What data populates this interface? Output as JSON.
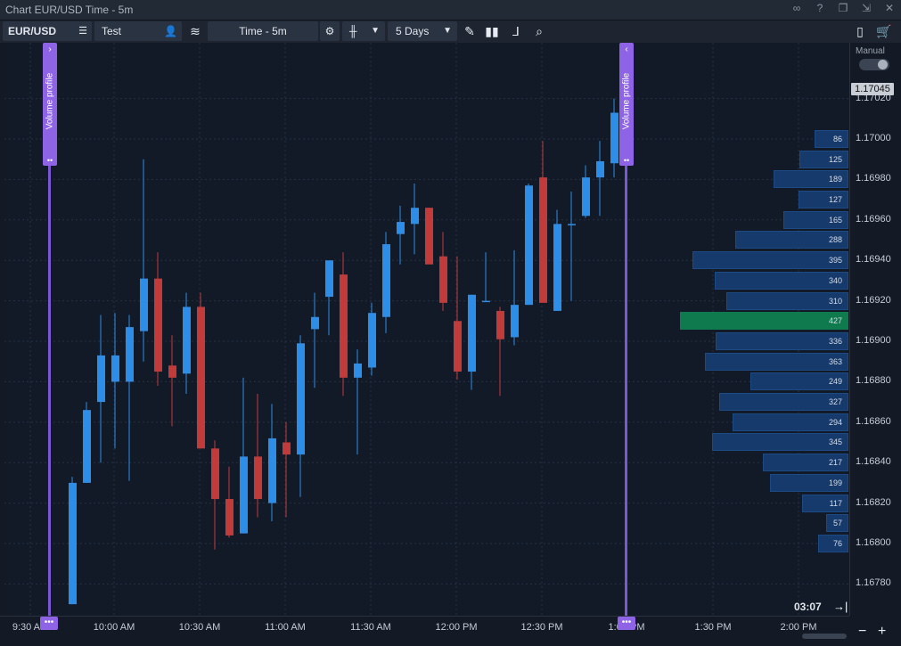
{
  "window": {
    "title": "Chart EUR/USD Time - 5m"
  },
  "toolbar": {
    "symbol": "EUR/USD",
    "account": "Test",
    "interval": "Time - 5m",
    "range": "5 Days"
  },
  "axis": {
    "manual_label": "Manual",
    "current_price": "1.17045",
    "countdown": "03:07",
    "price_labels": [
      "1.17020",
      "1.17000",
      "1.16980",
      "1.16960",
      "1.16940",
      "1.16920",
      "1.16900",
      "1.16880",
      "1.16860",
      "1.16840",
      "1.16820",
      "1.16800",
      "1.16780"
    ],
    "time_labels": [
      "9:30 AM",
      "10:00 AM",
      "10:30 AM",
      "11:00 AM",
      "11:30 AM",
      "12:00 PM",
      "12:30 PM",
      "1:00 PM",
      "1:30 PM",
      "2:00 PM"
    ]
  },
  "volume_profile": {
    "label": "Volume profile",
    "levels": [
      {
        "price": 1.17,
        "vol": 86
      },
      {
        "price": 1.1699,
        "vol": 125
      },
      {
        "price": 1.1698,
        "vol": 189
      },
      {
        "price": 1.1697,
        "vol": 127
      },
      {
        "price": 1.1696,
        "vol": 165
      },
      {
        "price": 1.1695,
        "vol": 288
      },
      {
        "price": 1.1694,
        "vol": 395
      },
      {
        "price": 1.1693,
        "vol": 340
      },
      {
        "price": 1.1692,
        "vol": 310
      },
      {
        "price": 1.1691,
        "vol": 427,
        "poc": true
      },
      {
        "price": 1.169,
        "vol": 336
      },
      {
        "price": 1.1689,
        "vol": 363
      },
      {
        "price": 1.1688,
        "vol": 249
      },
      {
        "price": 1.1687,
        "vol": 327
      },
      {
        "price": 1.1686,
        "vol": 294
      },
      {
        "price": 1.1685,
        "vol": 345
      },
      {
        "price": 1.1684,
        "vol": 217
      },
      {
        "price": 1.1683,
        "vol": 199
      },
      {
        "price": 1.1682,
        "vol": 117
      },
      {
        "price": 1.1681,
        "vol": 57
      },
      {
        "price": 1.168,
        "vol": 76
      }
    ]
  },
  "colors": {
    "up": "#2e8de6",
    "down": "#c23b3b",
    "poc": "#0e7a4e",
    "volume": "#163a6b",
    "profile": "#8e63e6"
  },
  "chart_data": {
    "type": "candlestick",
    "symbol": "EUR/USD",
    "interval": "5m",
    "ylim": [
      1.1677,
      1.1707
    ],
    "candles": [
      {
        "t": "09:35",
        "o": 1.1677,
        "h": 1.16833,
        "l": 1.1677,
        "c": 1.1683
      },
      {
        "t": "09:40",
        "o": 1.1683,
        "h": 1.1687,
        "l": 1.1683,
        "c": 1.16866
      },
      {
        "t": "09:45",
        "o": 1.1687,
        "h": 1.16913,
        "l": 1.1684,
        "c": 1.16893
      },
      {
        "t": "09:50",
        "o": 1.1688,
        "h": 1.16914,
        "l": 1.16847,
        "c": 1.16893
      },
      {
        "t": "09:55",
        "o": 1.1688,
        "h": 1.16913,
        "l": 1.16831,
        "c": 1.16907
      },
      {
        "t": "10:00",
        "o": 1.16905,
        "h": 1.1699,
        "l": 1.1689,
        "c": 1.16931
      },
      {
        "t": "10:05",
        "o": 1.16931,
        "h": 1.16944,
        "l": 1.16878,
        "c": 1.16885
      },
      {
        "t": "10:10",
        "o": 1.16888,
        "h": 1.16903,
        "l": 1.16858,
        "c": 1.16882
      },
      {
        "t": "10:15",
        "o": 1.16884,
        "h": 1.16924,
        "l": 1.16874,
        "c": 1.16917
      },
      {
        "t": "10:20",
        "o": 1.16917,
        "h": 1.16924,
        "l": 1.16849,
        "c": 1.16847
      },
      {
        "t": "10:25",
        "o": 1.16847,
        "h": 1.16851,
        "l": 1.16797,
        "c": 1.16822
      },
      {
        "t": "10:30",
        "o": 1.16822,
        "h": 1.16838,
        "l": 1.16803,
        "c": 1.16804
      },
      {
        "t": "10:35",
        "o": 1.16805,
        "h": 1.16882,
        "l": 1.16805,
        "c": 1.16843
      },
      {
        "t": "10:40",
        "o": 1.16843,
        "h": 1.16874,
        "l": 1.16813,
        "c": 1.16822
      },
      {
        "t": "10:45",
        "o": 1.1682,
        "h": 1.16869,
        "l": 1.16811,
        "c": 1.16852
      },
      {
        "t": "10:50",
        "o": 1.1685,
        "h": 1.1686,
        "l": 1.16813,
        "c": 1.16844
      },
      {
        "t": "10:55",
        "o": 1.16844,
        "h": 1.16903,
        "l": 1.16823,
        "c": 1.16899
      },
      {
        "t": "11:00",
        "o": 1.16906,
        "h": 1.16924,
        "l": 1.16877,
        "c": 1.16912
      },
      {
        "t": "11:05",
        "o": 1.16922,
        "h": 1.16939,
        "l": 1.16903,
        "c": 1.1694
      },
      {
        "t": "11:10",
        "o": 1.16933,
        "h": 1.16944,
        "l": 1.16873,
        "c": 1.16882
      },
      {
        "t": "11:15",
        "o": 1.16882,
        "h": 1.16896,
        "l": 1.16844,
        "c": 1.16889
      },
      {
        "t": "11:20",
        "o": 1.16887,
        "h": 1.16919,
        "l": 1.16883,
        "c": 1.16914
      },
      {
        "t": "11:25",
        "o": 1.16912,
        "h": 1.16954,
        "l": 1.16904,
        "c": 1.16948
      },
      {
        "t": "11:30",
        "o": 1.16953,
        "h": 1.16967,
        "l": 1.16938,
        "c": 1.16959
      },
      {
        "t": "11:35",
        "o": 1.16958,
        "h": 1.16978,
        "l": 1.16943,
        "c": 1.16966
      },
      {
        "t": "11:40",
        "o": 1.16966,
        "h": 1.16966,
        "l": 1.16941,
        "c": 1.16938
      },
      {
        "t": "11:45",
        "o": 1.16942,
        "h": 1.16954,
        "l": 1.16915,
        "c": 1.16919
      },
      {
        "t": "11:50",
        "o": 1.1691,
        "h": 1.16942,
        "l": 1.16881,
        "c": 1.16885
      },
      {
        "t": "11:55",
        "o": 1.16885,
        "h": 1.16923,
        "l": 1.16876,
        "c": 1.16923
      },
      {
        "t": "12:00",
        "o": 1.1692,
        "h": 1.16944,
        "l": 1.1692,
        "c": 1.1692
      },
      {
        "t": "12:05",
        "o": 1.16915,
        "h": 1.16917,
        "l": 1.16873,
        "c": 1.16901
      },
      {
        "t": "12:10",
        "o": 1.16902,
        "h": 1.16945,
        "l": 1.16898,
        "c": 1.16918
      },
      {
        "t": "12:15",
        "o": 1.16918,
        "h": 1.16978,
        "l": 1.16918,
        "c": 1.16977
      },
      {
        "t": "12:20",
        "o": 1.16981,
        "h": 1.16999,
        "l": 1.16924,
        "c": 1.16919
      },
      {
        "t": "12:25",
        "o": 1.16915,
        "h": 1.16965,
        "l": 1.16915,
        "c": 1.16958
      },
      {
        "t": "12:30",
        "o": 1.16958,
        "h": 1.16974,
        "l": 1.1692,
        "c": 1.16958
      },
      {
        "t": "12:35",
        "o": 1.16962,
        "h": 1.16987,
        "l": 1.16961,
        "c": 1.16981
      },
      {
        "t": "12:40",
        "o": 1.16981,
        "h": 1.16999,
        "l": 1.16962,
        "c": 1.16989
      },
      {
        "t": "12:45",
        "o": 1.16988,
        "h": 1.1702,
        "l": 1.16981,
        "c": 1.17013
      },
      {
        "t": "12:50",
        "o": 1.17013,
        "h": 1.1707,
        "l": 1.1699,
        "c": 1.17045
      }
    ]
  }
}
